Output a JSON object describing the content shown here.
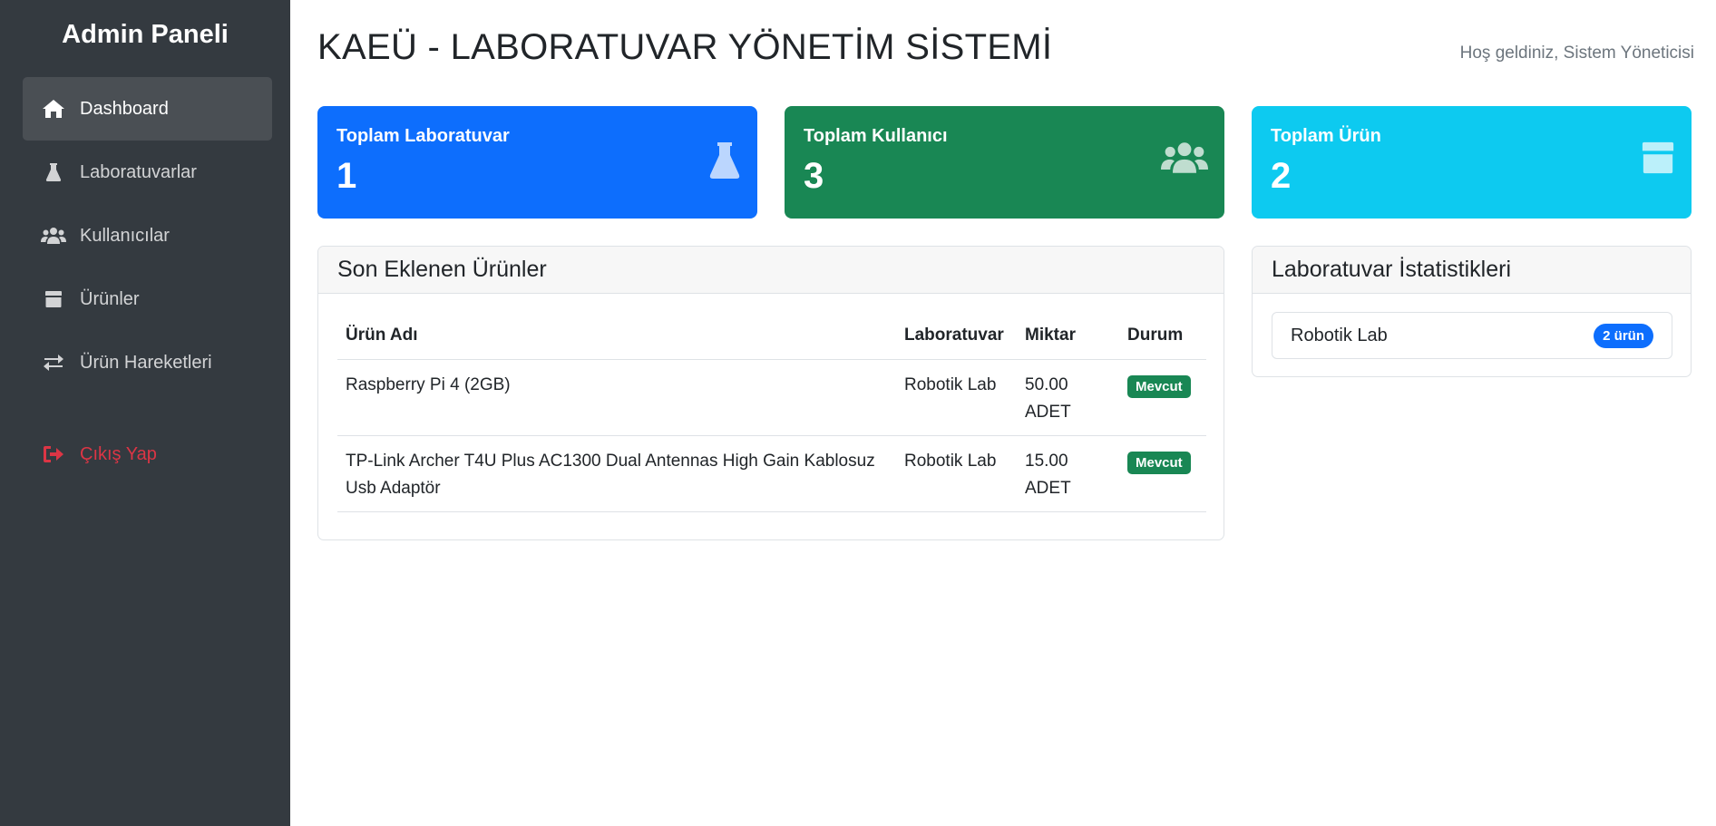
{
  "sidebar": {
    "brand": "Admin Paneli",
    "items": [
      {
        "label": "Dashboard",
        "icon": "home-icon"
      },
      {
        "label": "Laboratuvarlar",
        "icon": "flask-icon"
      },
      {
        "label": "Kullanıcılar",
        "icon": "users-icon"
      },
      {
        "label": "Ürünler",
        "icon": "box-icon"
      },
      {
        "label": "Ürün Hareketleri",
        "icon": "exchange-icon"
      }
    ],
    "logout": {
      "label": "Çıkış Yap",
      "icon": "sign-out-icon"
    }
  },
  "header": {
    "title": "KAEÜ - LABORATUVAR YÖNETİM SİSTEMİ",
    "welcome": "Hoş geldiniz, Sistem Yöneticisi"
  },
  "stats": [
    {
      "label": "Toplam Laboratuvar",
      "value": "1",
      "icon": "flask-icon",
      "color": "#0d6efd"
    },
    {
      "label": "Toplam Kullanıcı",
      "value": "3",
      "icon": "users-icon",
      "color": "#198754"
    },
    {
      "label": "Toplam Ürün",
      "value": "2",
      "icon": "box-icon",
      "color": "#0dcaf0"
    }
  ],
  "recent_products": {
    "title": "Son Eklenen Ürünler",
    "columns": [
      "Ürün Adı",
      "Laboratuvar",
      "Miktar",
      "Durum"
    ],
    "rows": [
      {
        "name": "Raspberry Pi 4 (2GB)",
        "lab": "Robotik Lab",
        "qty": "50.00",
        "unit": "ADET",
        "status": "Mevcut"
      },
      {
        "name": "TP-Link Archer T4U Plus AC1300 Dual Antennas High Gain Kablosuz Usb Adaptör",
        "lab": "Robotik Lab",
        "qty": "15.00",
        "unit": "ADET",
        "status": "Mevcut"
      }
    ]
  },
  "lab_stats": {
    "title": "Laboratuvar İstatistikleri",
    "items": [
      {
        "name": "Robotik Lab",
        "count": "2 ürün"
      }
    ]
  }
}
